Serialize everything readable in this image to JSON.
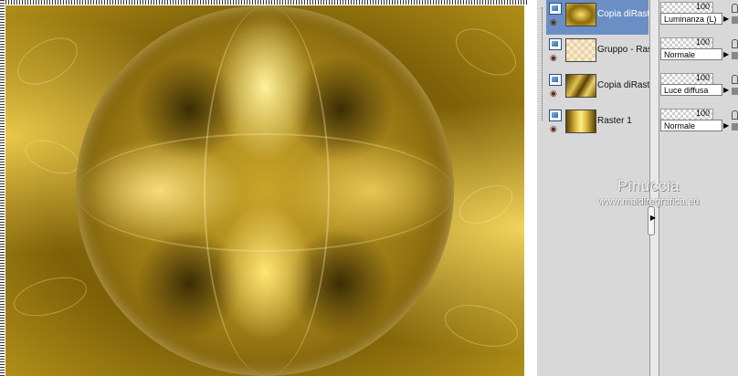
{
  "layers": [
    {
      "name": "Copia diRaster",
      "opacity": "100",
      "blend_mode": "Luminanza (L)",
      "selected": true
    },
    {
      "name": "Gruppo - Ras",
      "opacity": "100",
      "blend_mode": "Normale",
      "selected": false
    },
    {
      "name": "Copia diRaster",
      "opacity": "100",
      "blend_mode": "Luce diffusa",
      "selected": false
    },
    {
      "name": "Raster 1",
      "opacity": "100",
      "blend_mode": "Normale",
      "selected": false
    }
  ],
  "watermark": {
    "name": "Pinuccia",
    "url": "www.maidiregrafica.eu"
  },
  "icons": {
    "visibility": "eye-icon",
    "layer_type": "raster-layer-icon",
    "lock": "lock-icon",
    "dropdown": "triangle-right-icon"
  }
}
